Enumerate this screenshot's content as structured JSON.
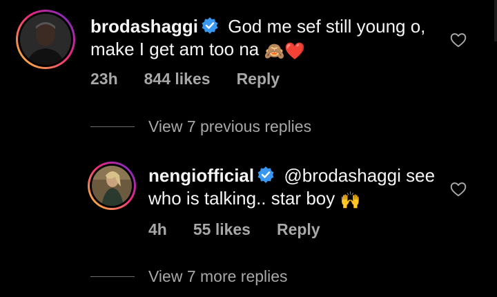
{
  "comments": [
    {
      "username": "brodashaggi",
      "text": "God me sef still young o, make I get am too na",
      "emoji": "🙈❤️",
      "time": "23h",
      "likes": "844 likes",
      "reply_label": "Reply"
    },
    {
      "username": "nengiofficial",
      "mention": "@brodashaggi",
      "text": "see who is talking.. star boy",
      "emoji": "🙌",
      "time": "4h",
      "likes": "55 likes",
      "reply_label": "Reply"
    }
  ],
  "view_replies": [
    "View 7 previous replies",
    "View 7 more replies"
  ],
  "colors": {
    "background": "#000000",
    "secondary_text": "#a8a8a8",
    "verified": "#3897f0"
  },
  "icons": [
    "verified-badge-icon",
    "heart-outline-icon"
  ]
}
